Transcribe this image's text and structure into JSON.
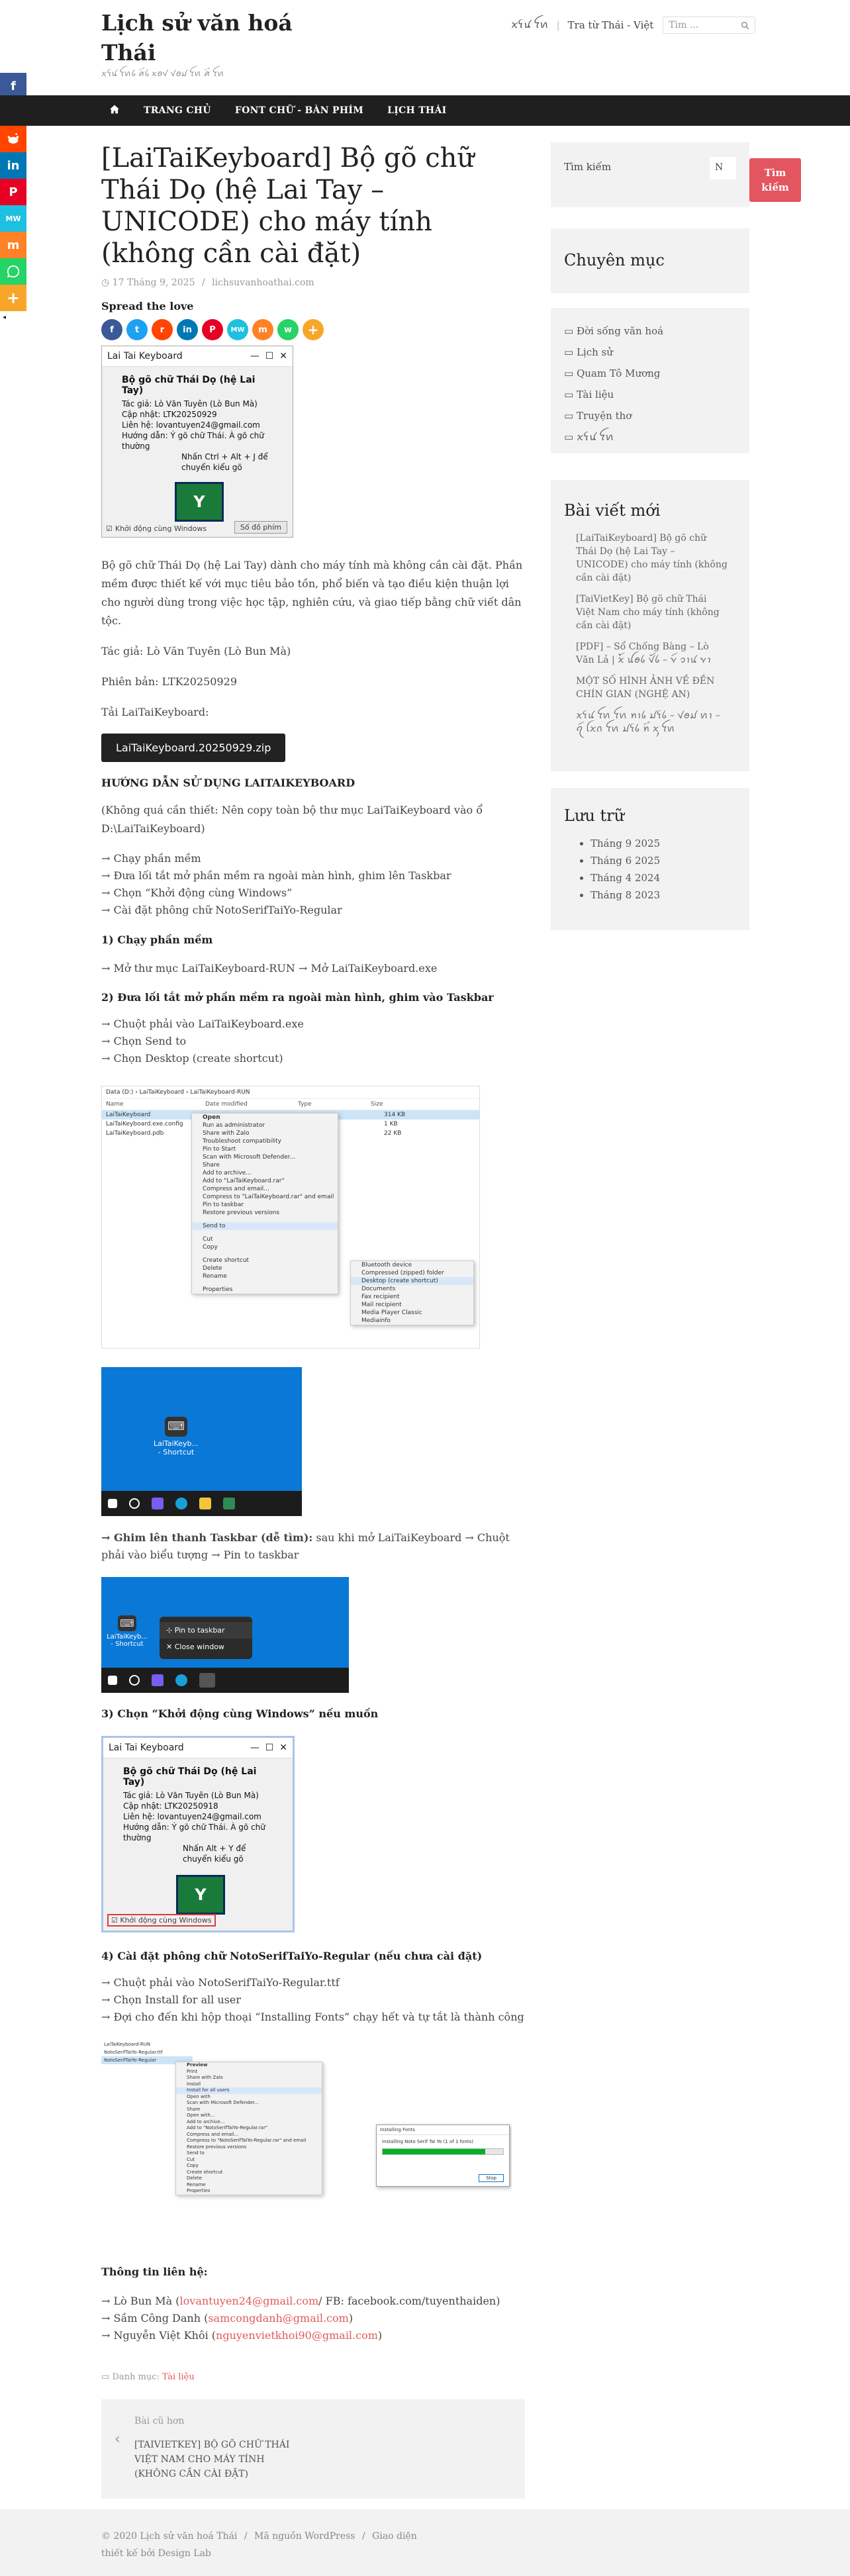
{
  "site": {
    "title": "Lịch sử văn hoá Thái",
    "description": "ꪎꪺꪙ ꪼꪕꪉ ꪁꪾꪉ ꪎꪮꪚ ꪚꪮꪣ ꪼꪕ ꪁꪾ ꪼꪕ"
  },
  "topnav": {
    "item1": "ꪎꪺꪙ ꪼꪕ",
    "item2": "Tra từ Thái - Việt",
    "search_placeholder": "Tìm ..."
  },
  "navbar": {
    "items": [
      "TRANG CHỦ",
      "FONT CHỮ - BÀN PHÍM",
      "LỊCH THÁI"
    ]
  },
  "share_bar": [
    "facebook",
    "twitter",
    "reddit",
    "linkedin",
    "pinterest",
    "mewe",
    "mix",
    "whatsapp",
    "more"
  ],
  "post": {
    "title": "[LaiTaiKeyboard] Bộ gõ chữ Thái Dọ (hệ Lai Tay – UNICODE) cho máy tính (không cần cài đặt)",
    "date": "17 Tháng 9, 2025",
    "author": "lichsuvanhoathai.com",
    "spread": "Spread the love",
    "intro": "Bộ gõ chữ Thái Dọ (hệ Lai Tay) dành cho máy tính mà không cần cài đặt. Phần mềm được thiết kế với mục tiêu bảo tồn, phổ biến và tạo điều kiện thuận lợi cho người dùng trong việc học tập, nghiên cứu, và giao tiếp bằng chữ viết dân tộc.",
    "author_line": "Tác giả: Lò Văn Tuyên (Lò Bun Mà)",
    "version": "Phiên bản: LTK20250929",
    "download_label": "Tải LaiTaiKeyboard:",
    "download_button": "LaiTaiKeyboard.20250929.zip",
    "guide_heading": "HƯỚNG DẪN SỬ DỤNG LAITAIKEYBOARD",
    "guide_note": "(Không quá cần thiết: Nên copy toàn bộ thư mục LaiTaiKeyboard vào ổ D:\\LaiTaiKeyboard)",
    "steps": [
      "→ Chạy phần mềm",
      "→ Đưa lối tắt mở phần mềm ra ngoài màn hình, ghim lên Taskbar",
      "→ Chọn “Khởi động cùng Windows”",
      "→ Cài đặt phông chữ NotoSerifTaiYo-Regular"
    ],
    "s1_heading": "1) Chạy phần mềm",
    "s1_text": "→ Mở thư mục LaiTaiKeyboard-RUN → Mở LaiTaiKeyboard.exe",
    "s2_heading": "2) Đưa lối tắt mở phần mềm ra ngoài màn hình, ghim vào Taskbar",
    "s2_lines": [
      "→ Chuột phải vào LaiTaiKeyboard.exe",
      "→ Chọn Send to",
      "→ Chọn Desktop (create shortcut)"
    ],
    "pin_bold": "→ Ghim lên thanh Taskbar (dễ tìm):",
    "pin_text": " sau khi mở LaiTaiKeyboard → Chuột phải vào biểu tượng → Pin to taskbar",
    "s3_heading": "3) Chọn “Khởi động cùng Windows” nếu muốn",
    "s4_heading": "4) Cài đặt phông chữ NotoSerifTaiYo-Regular (nếu chưa cài đặt)",
    "s4_lines": [
      "→ Chuột phải vào NotoSerifTaiYo-Regular.ttf",
      "→ Chọn Install for all user",
      "→ Đợi cho đến khi hộp thoại “Installing Fonts” chạy hết và tự tắt là thành công"
    ],
    "contact_heading": "Thông tin liên hệ:",
    "contacts": [
      {
        "pre": "→ Lò Bun Mà (",
        "email": "lovantuyen24@gmail.com",
        "post": "/ FB: facebook.com/tuyenthaiden)"
      },
      {
        "pre": "→ Sầm Công Danh (",
        "email": "samcongdanh@gmail.com",
        "post": ")"
      },
      {
        "pre": "→ Nguyễn Việt Khôi (",
        "email": "nguyenvietkhoi90@gmail.com",
        "post": ")"
      }
    ],
    "category_label": "Danh mục:",
    "category": "Tài liệu",
    "prev_label": "Bài cũ hơn",
    "prev_title": "[TAIVIETKEY] BỘ GÕ CHỮ THÁI VIỆT NAM CHO MÁY TÍNH (KHÔNG CẦN CÀI ĐẶT)"
  },
  "app_window": {
    "title": "Lai Tai Keyboard",
    "heading": "Bộ gõ chữ Thái Dọ (hệ Lai Tay)",
    "lines": [
      "Tác giả: Lò Văn Tuyên (Lò Bun Mà)",
      "Cập nhật: LTK20250929",
      "Liên hệ: lovantuyen24@gmail.com",
      "Hướng dẫn: Ý gõ chữ Thái. À gõ chữ thường",
      "Nhấn Ctrl + Alt + J để chuyển kiểu gõ"
    ],
    "key": "Y",
    "checkbox": "Khởi động cùng Windows",
    "button": "Số đồ phím"
  },
  "app_window2": {
    "title": "Lai Tai Keyboard",
    "heading": "Bộ gõ chữ Thái Dọ (hệ Lai Tay)",
    "lines": [
      "Tác giả: Lò Văn Tuyên (Lò Bun Mà)",
      "Cập nhật: LTK20250918",
      "Liên hệ: lovantuyen24@gmail.com",
      "Hướng dẫn: Ý gõ chữ Thái. À gõ chữ thường",
      "Nhấn Alt + Y để chuyển kiểu gõ"
    ],
    "key": "Y",
    "checkbox": "Khởi động cùng Windows"
  },
  "explorer": {
    "path": "Data (D:) › LaiTaiKeyboard › LaiTaiKeyboard-RUN",
    "cols": [
      "Name",
      "Date modified",
      "Type",
      "Size"
    ],
    "files": [
      "LaiTaiKeyboard",
      "LaiTaiKeyboard.exe.config",
      "LaiTaiKeyboard.pdb"
    ],
    "sizes": [
      "314 KB",
      "1 KB",
      "22 KB"
    ],
    "menu": [
      "Open",
      "Run as administrator",
      "Share with Zalo",
      "Troubleshoot compatibility",
      "Pin to Start",
      "Scan with Microsoft Defender...",
      "Share",
      "Add to archive...",
      "Add to \"LaiTaiKeyboard.rar\"",
      "Compress and email...",
      "Compress to \"LaiTaiKeyboard.rar\" and email",
      "Pin to taskbar",
      "Restore previous versions",
      "Send to",
      "Cut",
      "Copy",
      "Create shortcut",
      "Delete",
      "Rename",
      "Properties"
    ],
    "submenu": [
      "Bluetooth device",
      "Compressed (zipped) folder",
      "Desktop (create shortcut)",
      "Documents",
      "Fax recipient",
      "Mail recipient",
      "Media Player Classic",
      "Mediainfo"
    ]
  },
  "desktop": {
    "shortcut": "LaiTaiKeyb... - Shortcut"
  },
  "pin_menu": {
    "items": [
      "Pin to taskbar",
      "Close window"
    ],
    "shortcut": "LaiTaiKeyb... - Shortcut"
  },
  "font_shot": {
    "files": [
      "LaiTaiKeyboard-RUN",
      "NotoSerifTaiYo-Regular.ttf",
      "NotoSerifTaiYo-Regular"
    ],
    "menu": [
      "Preview",
      "Print",
      "Share with Zalo",
      "Install",
      "Install for all users",
      "Open with",
      "Scan with Microsoft Defender...",
      "Share",
      "Open with...",
      "Add to archive...",
      "Add to \"NotoSerifTaiYo-Regular.rar\"",
      "Compress and email...",
      "Compress to \"NotoSerifTaiYo-Regular.rar\" and email",
      "Restore previous versions",
      "Send to",
      "Cut",
      "Copy",
      "Create shortcut",
      "Delete",
      "Rename",
      "Properties"
    ],
    "dialog_title": "Installing Fonts",
    "dialog_text": "Installing Noto Serif Tai Yo (1 of 1 fonts)",
    "dialog_button": "Stop"
  },
  "sidebar": {
    "search_label": "Tìm kiếm",
    "search_value": "N",
    "search_button": "Tìm kiếm",
    "categories_title": "Chuyên mục",
    "categories": [
      "Đời sống văn hoá",
      "Lịch sử",
      "Quam Tô Mương",
      "Tài liệu",
      "Truyện thơ",
      "ꪎꪺꪙ ꪼꪕ"
    ],
    "recent_title": "Bài viết mới",
    "recent": [
      "[LaiTaiKeyboard] Bộ gõ chữ Thái Dọ (hệ Lai Tay – UNICODE) cho máy tính (không cần cài đặt)",
      "[TaiVietKey] Bộ gõ chữ Thái Việt Nam cho máy tính (không cần cài đặt)",
      "[PDF] – Sổ Chống Bàng – Lò Văn Lả | ꪎꪳ ꪊꪮꪉ ꪚꪰꪉ – ꪩꪷ ꪫꪱꪙ ꪩꪱ",
      "MỘT SỐ HÌNH ẢNH VỀ ĐỀN CHÍN GIAN (NGHỆ AN)",
      "ꪎꪺꪙ ꪼꪕ ꪼꪕ ꪀꪱꪉ ꪣꪺꪉ – ꪚꪮꪣ ꪕꪱ – ꪖꪷ ꪶꪎꪒ ꪼꪕ ꪣꪺꪉ ꪀꪾ ꪎꪴ ꪼꪕ"
    ],
    "archive_title": "Lưu trữ",
    "archive": [
      "Tháng 9 2025",
      "Tháng 6 2025",
      "Tháng 4 2024",
      "Tháng 8 2023"
    ]
  },
  "footer": {
    "copyright": "© 2020 Lịch sử văn hoá Thái",
    "wp": "Mã nguồn WordPress",
    "theme": "Giao diện thiết kế bởi Design Lab"
  },
  "colors": {
    "link": "#e15a5a",
    "button_red": "#e3555f",
    "nav_bg": "#1f1f1f",
    "taskbar": "#1c1c1c",
    "desktop_blue": "#0a78d6"
  }
}
